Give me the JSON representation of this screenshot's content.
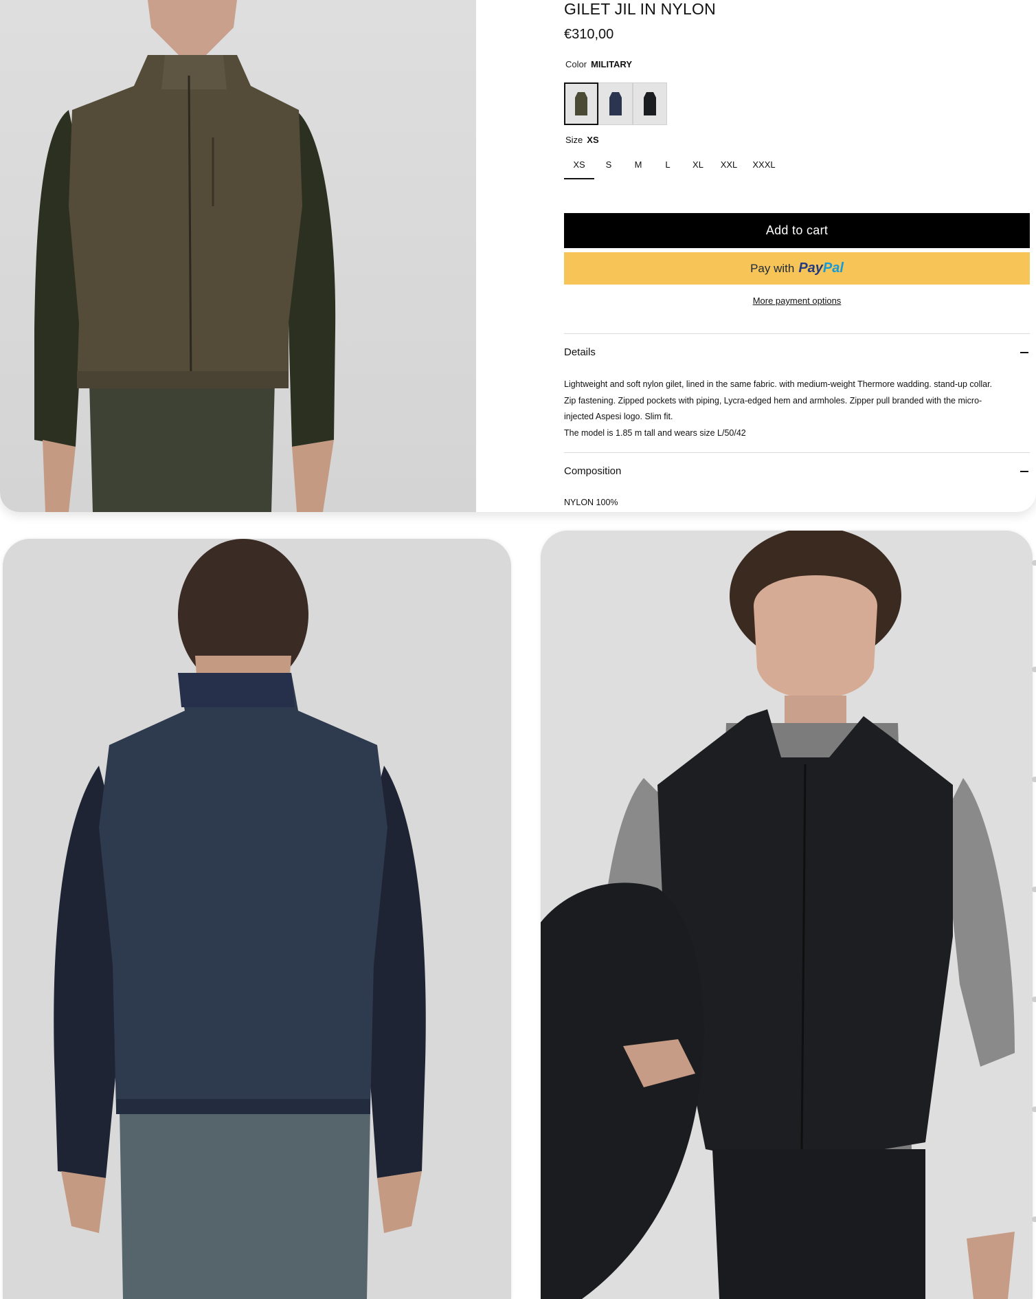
{
  "product": {
    "title": "GILET JIL IN NYLON",
    "price": "€310,00",
    "color_label": "Color",
    "color_value": "MILITARY",
    "swatches": [
      {
        "name": "military",
        "hex": "#4a4a35"
      },
      {
        "name": "navy",
        "hex": "#2b3550"
      },
      {
        "name": "black",
        "hex": "#1c1d20"
      }
    ],
    "size_label": "Size",
    "size_value": "XS",
    "sizes": [
      "XS",
      "S",
      "M",
      "L",
      "XL",
      "XXL",
      "XXXL"
    ]
  },
  "actions": {
    "add_to_cart": "Add to cart",
    "paypal_prefix": "Pay with",
    "paypal_pay": "Pay",
    "paypal_pal": "Pal",
    "more_payment": "More payment options"
  },
  "accordion": {
    "details_title": "Details",
    "details_lines": [
      "Lightweight and soft nylon gilet, lined in the same fabric. with medium-weight Thermore wadding. stand-up collar.",
      "Zip fastening. Zipped pockets with piping, Lycra-edged hem and armholes. Zipper pull branded with the micro-",
      "injected Aspesi logo. Slim fit.",
      "The model is 1.85 m tall and wears size L/50/42"
    ],
    "composition_title": "Composition",
    "composition_text": "NYLON 100%"
  },
  "colors": {
    "cart_bg": "#000000",
    "paypal_bg": "#f7c557",
    "paypal_blue_dark": "#253b80",
    "paypal_blue_light": "#179bd7"
  }
}
